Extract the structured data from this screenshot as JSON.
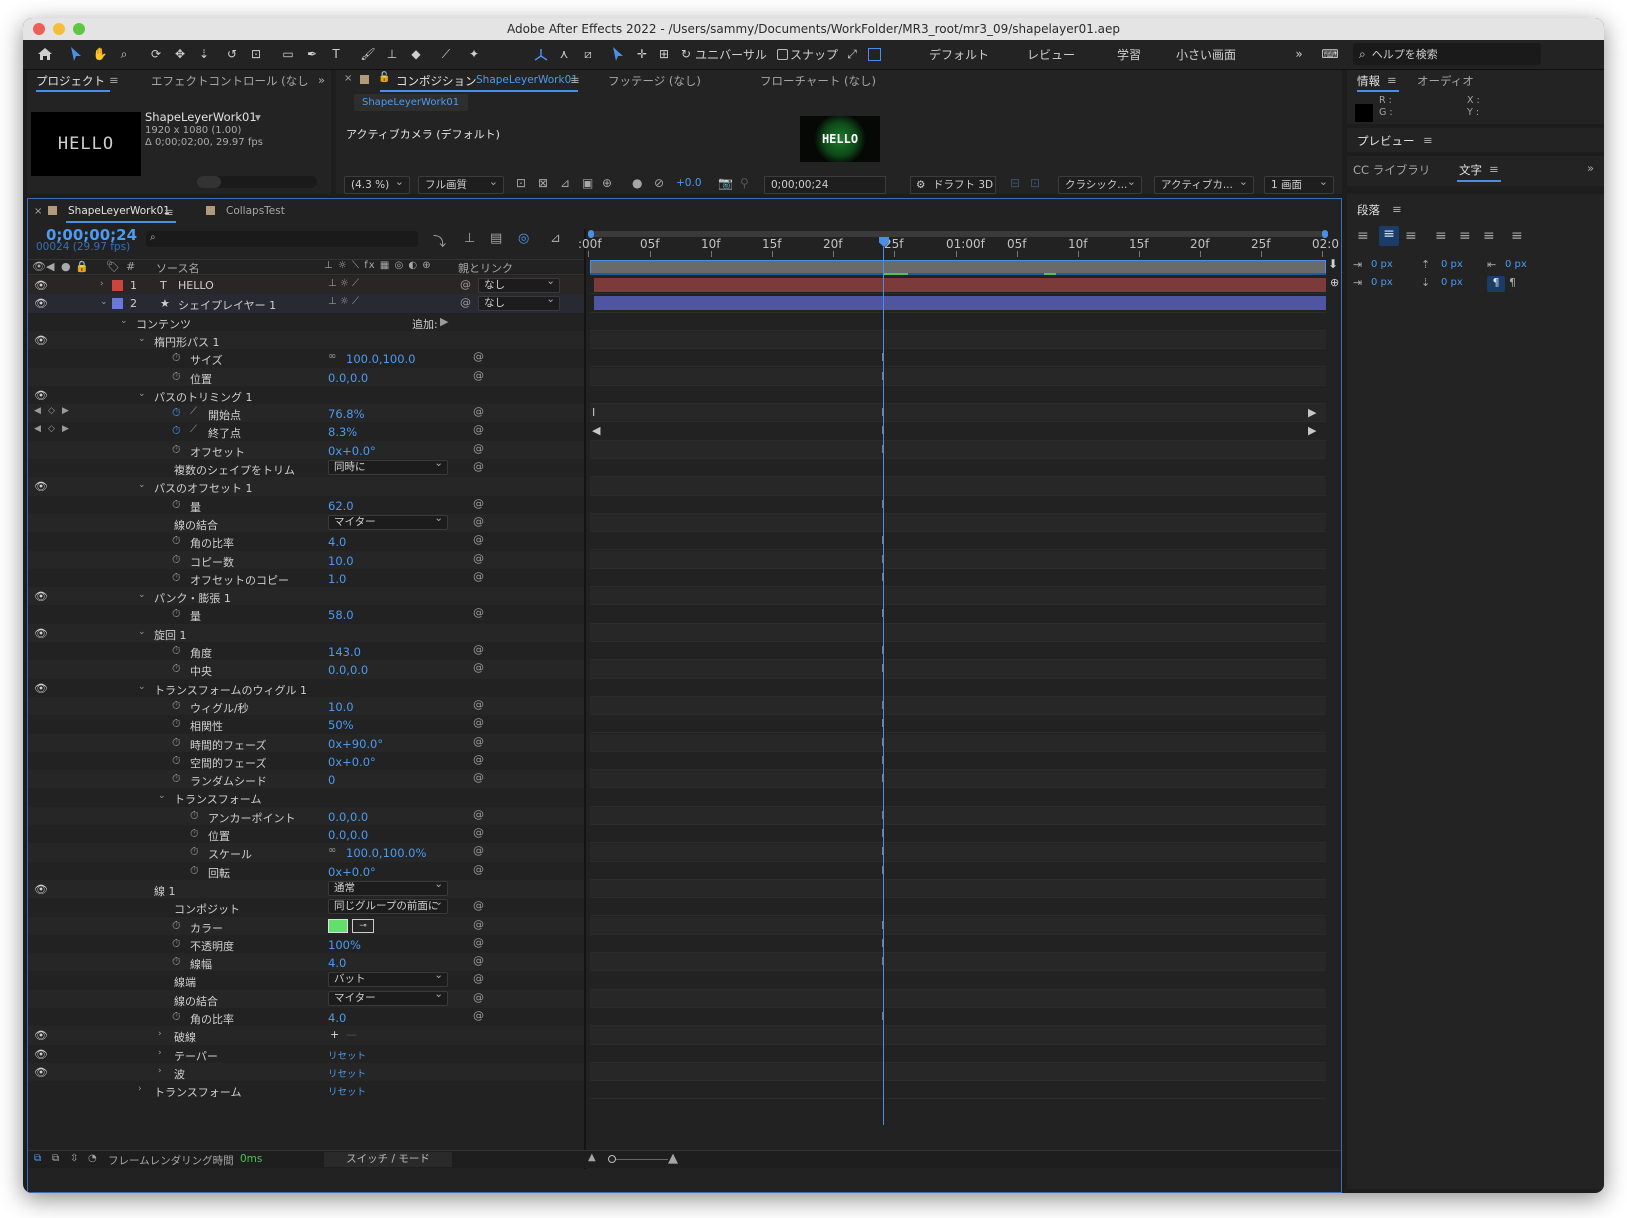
{
  "app": {
    "title": "Adobe After Effects 2022 - /Users/sammy/Documents/WorkFolder/MR3_root/mr3_09/shapelayer01.aep"
  },
  "toolbar": {
    "universal": "ユニバーサル",
    "snap": "スナップ",
    "workspaces": [
      "デフォルト",
      "レビュー",
      "学習",
      "小さい画面"
    ],
    "help_placeholder": "ヘルプを検索"
  },
  "project": {
    "tab": "プロジェクト",
    "effect_tab": "エフェクトコントロール (なし",
    "thumb_text": "HELLO",
    "comp_name": "ShapeLeyerWork01",
    "size": "1920 x 1080 (1.00)",
    "duration": "Δ 0;00;02;00, 29.97 fps"
  },
  "composition": {
    "close": "×",
    "tab_label": "コンポジション",
    "tab_name": "ShapeLeyerWork01",
    "footage_tab": "フッテージ (なし)",
    "flowchart_tab": "フローチャート (なし)",
    "subtab": "ShapeLeyerWork01",
    "camera": "アクティブカメラ (デフォルト)",
    "preview_text": "HELLO",
    "zoom": "(4.3 %)",
    "quality": "フル画質",
    "exposure": "+0.0",
    "timecode": "0;00;00;24",
    "draft3d": "ドラフト 3D",
    "renderer": "クラシック...",
    "camera_sel": "アクティブカ...",
    "view": "1 画面"
  },
  "right": {
    "info_tab": "情報",
    "audio_tab": "オーディオ",
    "r": "R :",
    "g": "G :",
    "x": "X :",
    "y": "Y :",
    "preview": "プレビュー",
    "cc_library": "CC ライブラリ",
    "char_tab": "文字",
    "paragraph": "段落",
    "px_values": [
      "0 px",
      "0 px",
      "0 px",
      "0 px",
      "0 px"
    ]
  },
  "timeline": {
    "tab1": "ShapeLeyerWork01",
    "tab2": "CollapsTest",
    "timecode": "0;00;00;24",
    "frames": "00024 (29.97 fps)",
    "col_num": "#",
    "col_source": "ソース名",
    "col_parent": "親とリンク",
    "ticks": [
      ":00f",
      "05f",
      "10f",
      "15f",
      "20f",
      "25f",
      "01:00f",
      "05f",
      "10f",
      "15f",
      "20f",
      "25f",
      "02:0"
    ],
    "footer_render": "フレームレンダリング時間",
    "footer_ms": "0ms",
    "footer_switch": "スイッチ / モード"
  },
  "layers": [
    {
      "num": "1",
      "type": "T",
      "name": "HELLO",
      "parent": "なし",
      "color": "#c8463f",
      "bar": "#7c3a3a"
    },
    {
      "num": "2",
      "type": "★",
      "name": "シェイプレイヤー 1",
      "parent": "なし",
      "color": "#6a78d8",
      "bar": "#4f55a0"
    }
  ],
  "properties": [
    {
      "indent": 1,
      "name": "コンテンツ",
      "value": "",
      "add": "追加:"
    },
    {
      "indent": 2,
      "name": "楕円形パス 1",
      "value": "",
      "eye": true
    },
    {
      "indent": 3,
      "name": "サイズ",
      "value": "100.0,100.0",
      "stop": true,
      "link": true,
      "spiral": true
    },
    {
      "indent": 3,
      "name": "位置",
      "value": "0.0,0.0",
      "stop": true,
      "spiral": true
    },
    {
      "indent": 2,
      "name": "パスのトリミング 1",
      "value": "",
      "eye": true
    },
    {
      "indent": 3,
      "name": "開始点",
      "value": "76.8%",
      "stop": true,
      "graph": true,
      "spiral": true,
      "keyed": true
    },
    {
      "indent": 3,
      "name": "終了点",
      "value": "8.3%",
      "stop": true,
      "graph": true,
      "spiral": true,
      "keyed": true
    },
    {
      "indent": 3,
      "name": "オフセット",
      "value": "0x+0.0°",
      "stop": true,
      "spiral": true
    },
    {
      "indent": 3,
      "name": "複数のシェイプをトリム",
      "value": "",
      "select": "同時に",
      "spiral": true
    },
    {
      "indent": 2,
      "name": "パスのオフセット 1",
      "value": "",
      "eye": true
    },
    {
      "indent": 3,
      "name": "量",
      "value": "62.0",
      "stop": true,
      "spiral": true
    },
    {
      "indent": 3,
      "name": "線の結合",
      "value": "",
      "select": "マイター",
      "spiral": true
    },
    {
      "indent": 3,
      "name": "角の比率",
      "value": "4.0",
      "stop": true,
      "spiral": true
    },
    {
      "indent": 3,
      "name": "コピー数",
      "value": "10.0",
      "stop": true,
      "spiral": true
    },
    {
      "indent": 3,
      "name": "オフセットのコピー",
      "value": "1.0",
      "stop": true,
      "spiral": true
    },
    {
      "indent": 2,
      "name": "パンク・膨張 1",
      "value": "",
      "eye": true
    },
    {
      "indent": 3,
      "name": "量",
      "value": "58.0",
      "stop": true,
      "spiral": true
    },
    {
      "indent": 2,
      "name": "旋回 1",
      "value": "",
      "eye": true
    },
    {
      "indent": 3,
      "name": "角度",
      "value": "143.0",
      "stop": true,
      "spiral": true
    },
    {
      "indent": 3,
      "name": "中央",
      "value": "0.0,0.0",
      "stop": true,
      "spiral": true
    },
    {
      "indent": 2,
      "name": "トランスフォームのウィグル 1",
      "value": "",
      "eye": true
    },
    {
      "indent": 3,
      "name": "ウィグル/秒",
      "value": "10.0",
      "stop": true,
      "spiral": true
    },
    {
      "indent": 3,
      "name": "相関性",
      "value": "50%",
      "stop": true,
      "spiral": true
    },
    {
      "indent": 3,
      "name": "時間的フェーズ",
      "value": "0x+90.0°",
      "stop": true,
      "spiral": true
    },
    {
      "indent": 3,
      "name": "空間的フェーズ",
      "value": "0x+0.0°",
      "stop": true,
      "spiral": true
    },
    {
      "indent": 3,
      "name": "ランダムシード",
      "value": "0",
      "stop": true,
      "spiral": true
    },
    {
      "indent": 3,
      "name": "トランスフォーム",
      "value": "",
      "twirl": true
    },
    {
      "indent": 4,
      "name": "アンカーポイント",
      "value": "0.0,0.0",
      "stop": true,
      "spiral": true
    },
    {
      "indent": 4,
      "name": "位置",
      "value": "0.0,0.0",
      "stop": true,
      "spiral": true
    },
    {
      "indent": 4,
      "name": "スケール",
      "value": "100.0,100.0%",
      "stop": true,
      "link": true,
      "spiral": true
    },
    {
      "indent": 4,
      "name": "回転",
      "value": "0x+0.0°",
      "stop": true,
      "spiral": true
    },
    {
      "indent": 2,
      "name": "線 1",
      "value": "",
      "select": "通常",
      "eye": true
    },
    {
      "indent": 3,
      "name": "コンポジット",
      "value": "",
      "select": "同じグループの前面に",
      "spiral": true
    },
    {
      "indent": 3,
      "name": "カラー",
      "value": "",
      "color": "#62e06a",
      "stop": true,
      "spiral": true
    },
    {
      "indent": 3,
      "name": "不透明度",
      "value": "100%",
      "stop": true,
      "spiral": true
    },
    {
      "indent": 3,
      "name": "線幅",
      "value": "4.0",
      "stop": true,
      "spiral": true
    },
    {
      "indent": 3,
      "name": "線端",
      "value": "",
      "select": "バット",
      "spiral": true
    },
    {
      "indent": 3,
      "name": "線の結合",
      "value": "",
      "select": "マイター",
      "spiral": true
    },
    {
      "indent": 3,
      "name": "角の比率",
      "value": "4.0",
      "stop": true,
      "spiral": true
    },
    {
      "indent": 3,
      "name": "破線",
      "value": "",
      "eye": true,
      "collapsed": true,
      "plus": true
    },
    {
      "indent": 3,
      "name": "テーパー",
      "value": "リセット",
      "eye": true,
      "collapsed": true
    },
    {
      "indent": 3,
      "name": "波",
      "value": "リセット",
      "eye": true,
      "collapsed": true
    },
    {
      "indent": 2,
      "name": "トランスフォーム",
      "value": "リセット",
      "collapsed": true
    }
  ],
  "colors": {
    "accent": "#4a8fe7",
    "value_blue": "#4c9bf0",
    "panel": "#232323"
  }
}
